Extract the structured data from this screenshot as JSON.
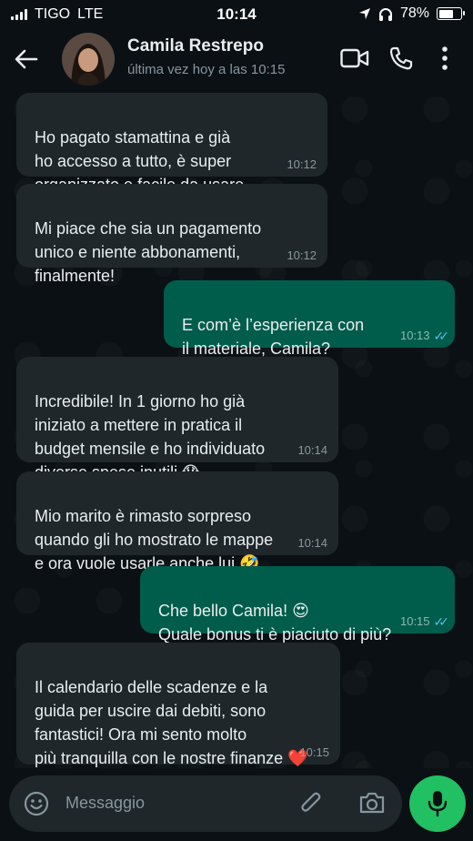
{
  "status_bar": {
    "carrier": "TIGO",
    "network": "LTE",
    "time": "10:14",
    "battery": "78%",
    "battery_level": 0.78
  },
  "header": {
    "contact_name": "Camila Restrepo",
    "last_seen": "última vez hoy a las 10:15",
    "icons": [
      "back-arrow-icon",
      "video-call-icon",
      "phone-icon",
      "more-options-icon"
    ]
  },
  "messages": [
    {
      "direction": "in",
      "text": "Ho pagato stamattina e già\nho accesso a tutto, è super\norganizzato e facile da usare",
      "time": "10:12"
    },
    {
      "direction": "in",
      "text": "Mi piace che sia un pagamento\nunico e niente abbonamenti,\nfinalmente!",
      "time": "10:12"
    },
    {
      "direction": "out",
      "text": "E com’è l’esperienza con\nil materiale, Camila?",
      "time": "10:13",
      "read": true
    },
    {
      "direction": "in",
      "text": "Incredibile! In 1 giorno ho già\niniziato a mettere in pratica il\nbudget mensile e ho individuato\ndiverse spese inutili 😱",
      "time": "10:14"
    },
    {
      "direction": "in",
      "text": "Mio marito è rimasto sorpreso\nquando gli ho mostrato le mappe\ne ora vuole usarle anche lui 🤣",
      "time": "10:14"
    },
    {
      "direction": "out",
      "text": "Che bello Camila! 😍\nQuale bonus ti è piaciuto di più?",
      "time": "10:15",
      "read": true
    },
    {
      "direction": "in",
      "text": "Il calendario delle scadenze e la\nguida per uscire dai debiti, sono\nfantastici! Ora mi sento molto\npiù tranquilla con le nostre finanze ❤️",
      "time": "10:15"
    }
  ],
  "input": {
    "placeholder": "Messaggio",
    "icons": [
      "emoji-icon",
      "attachment-icon",
      "camera-icon",
      "microphone-icon"
    ]
  },
  "colors": {
    "background": "#0b1014",
    "incoming_bubble": "#1f272a",
    "outgoing_bubble": "#005c4b",
    "read_ticks": "#53bdeb",
    "mic_button": "#21c063"
  }
}
